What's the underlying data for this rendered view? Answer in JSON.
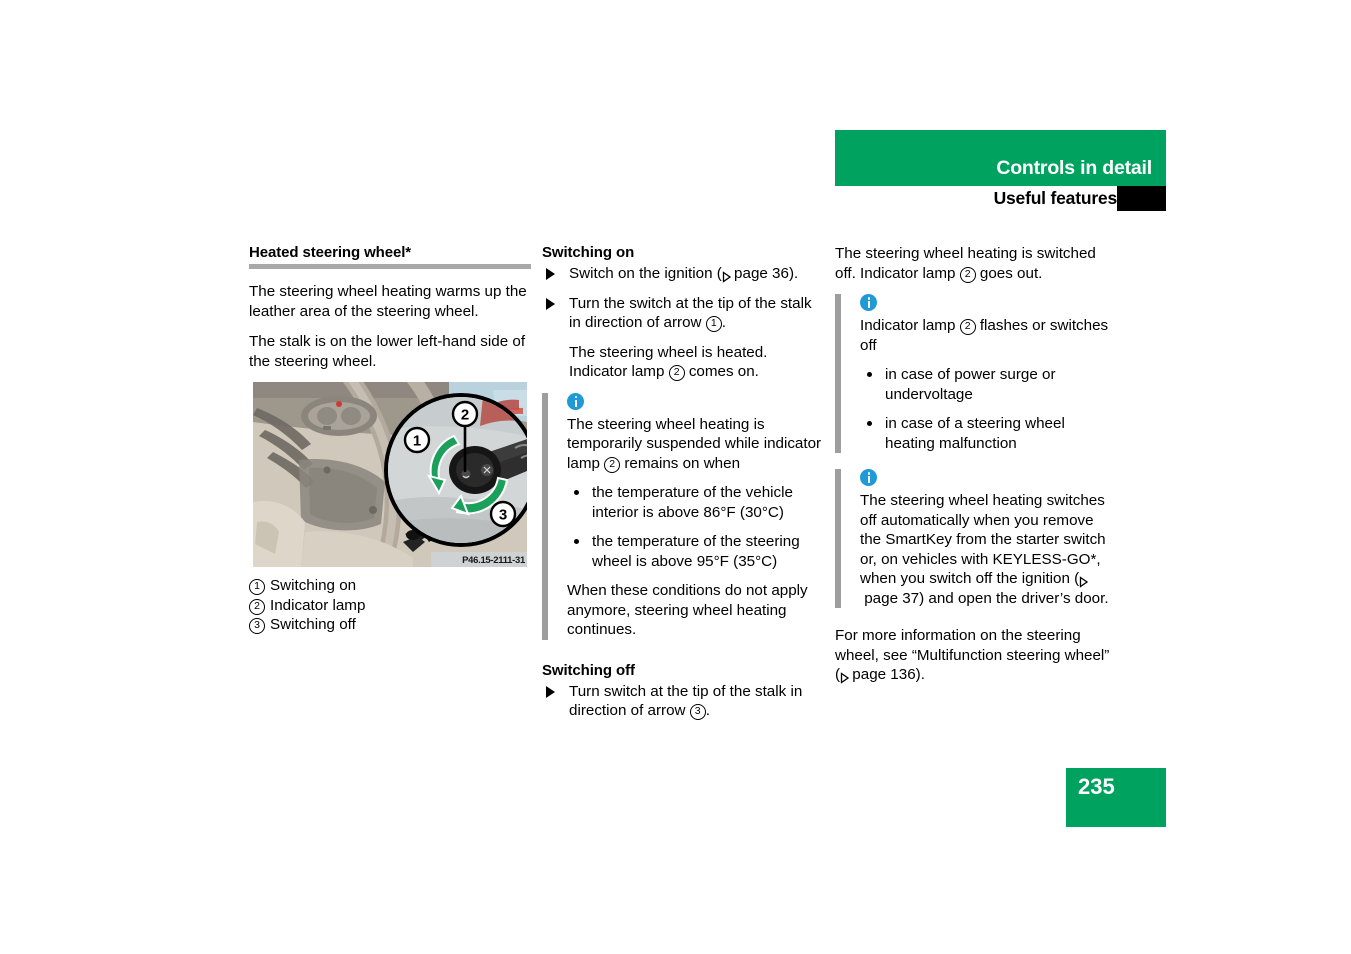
{
  "header": {
    "title": "Controls in detail",
    "subtitle": "Useful features",
    "banner_color": "#00a260",
    "tab_color": "#000000"
  },
  "page_number": "235",
  "left_column": {
    "heading": "Heated steering wheel*",
    "paragraph_1": "The steering wheel heating warms up the leather area of the steering wheel.",
    "paragraph_2": "The stalk is on the lower left-hand side of the steering wheel.",
    "figure": {
      "alt": "Steering column stalk with magnified detail of the switch tip",
      "code": "P46.15-2111-31",
      "callouts": [
        "1",
        "2",
        "3"
      ]
    },
    "legend": [
      {
        "num": "1",
        "label": "Switching on"
      },
      {
        "num": "2",
        "label": "Indicator lamp"
      },
      {
        "num": "3",
        "label": "Switching off"
      }
    ]
  },
  "middle_column": {
    "heading_on": "Switching on",
    "step_1": {
      "text_before": "Switch on the ignition (",
      "page_word": "page 36",
      "text_after": ")."
    },
    "step_2": {
      "text_before": "Turn the switch at the tip of the stalk in direction of arrow ",
      "num": "1",
      "text_after": "."
    },
    "step_2_result": {
      "text_before": "The steering wheel is heated. Indicator lamp ",
      "num": "2",
      "text_after": " comes on."
    },
    "info": {
      "icon": "info-icon",
      "paragraph_1_before": "The steering wheel heating is temporarily suspended while indicator lamp ",
      "paragraph_1_num": "2",
      "paragraph_1_after": " remains on when",
      "bullets": [
        "the temperature of the vehicle interior is above 86°F (30°C)",
        "the temperature of the steering wheel is above 95°F (35°C)"
      ],
      "paragraph_2": "When these conditions do not apply anymore, steering wheel heating continues."
    },
    "heading_off": "Switching off",
    "step_3": {
      "text_before": "Turn switch at the tip of the stalk in direction of arrow ",
      "num": "3",
      "text_after": "."
    }
  },
  "right_column": {
    "result_before": "The steering wheel heating is switched off. Indicator lamp ",
    "result_num": "2",
    "result_after": " goes out.",
    "info_1": {
      "icon": "info-icon",
      "lead_before": "Indicator lamp ",
      "lead_num": "2",
      "lead_after": " flashes or switches off",
      "bullets": [
        "in case of power surge or undervoltage",
        "in case of a steering wheel heating malfunction"
      ]
    },
    "info_2": {
      "icon": "info-icon",
      "text_before": "The steering wheel heating switches off automatically when you remove the SmartKey from the starter switch or, on vehicles with KEYLESS-GO*, when you switch off the ignition (",
      "page_word": "page 37",
      "text_after": ") and open the driver’s door."
    },
    "closing_before": "For more information on the steering wheel, see “Multifunction steering wheel” (",
    "closing_page": "page 136",
    "closing_after": ")."
  }
}
